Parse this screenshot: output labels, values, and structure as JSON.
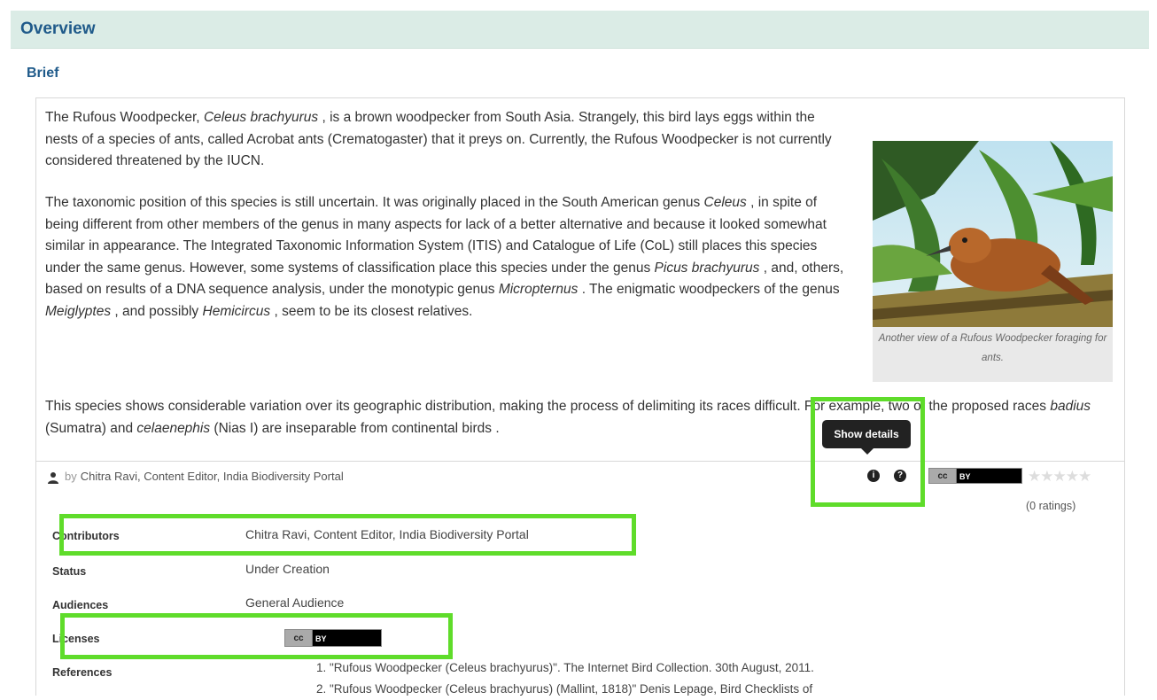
{
  "section": {
    "title": "Overview",
    "subtitle": "Brief"
  },
  "brief": {
    "p1_pre": "The Rufous Woodpecker, ",
    "p1_species": "Celeus brachyurus",
    "p1_post": " , is a brown woodpecker from South Asia. Strangely, this bird lays eggs within the nests of a species of ants, called Acrobat ants (Crematogaster) that it preys on. Currently, the Rufous Woodpecker is not currently considered threatened by the IUCN.",
    "p2_a": "The taxonomic position of this species is still uncertain. It was originally placed in the South American genus ",
    "p2_genus1": "Celeus",
    "p2_b": " , in spite of being different from other members of the genus in many aspects for lack of a better alternative and because it looked somewhat similar in appearance. The Integrated Taxonomic Information System (ITIS) and Catalogue of Life (CoL) still places this species under the same genus. However, some systems of classification place this species under the genus ",
    "p2_genus2": "Picus brachyurus",
    "p2_c": " , and, others, based on results of a DNA sequence analysis, under the monotypic genus ",
    "p2_genus3": "Micropternus",
    "p2_d": " . The enigmatic woodpeckers of the genus ",
    "p2_genus4": "Meiglyptes",
    "p2_e": " , and possibly ",
    "p2_genus5": "Hemicircus",
    "p2_f": " , seem to be its closest relatives.",
    "p3_a": "This species shows considerable variation over its geographic distribution, making the process of delimiting its races difficult. For example, two of the proposed races ",
    "p3_race1": "badius",
    "p3_b": "  (Sumatra) and ",
    "p3_race2": "celaenephis",
    "p3_c": "  (Nias I) are inseparable from continental birds ."
  },
  "figure": {
    "caption": "Another view of a Rufous Woodpecker foraging for ants."
  },
  "attribution": {
    "by_prefix": "by",
    "author": "Chitra Ravi, Content Editor, India Biodiversity Portal"
  },
  "tooltip": {
    "text": "Show details"
  },
  "buttons": {
    "details_icon": "info-icon",
    "help_icon": "help-icon"
  },
  "license_badge": {
    "cc": "cc",
    "by": "BY"
  },
  "rating": {
    "stars": "★★★★★",
    "count_text": "(0 ratings)"
  },
  "details": {
    "contributors_label": "Contributors",
    "contributors_value": "Chitra Ravi, Content Editor, India Biodiversity Portal",
    "status_label": "Status",
    "status_value": "Under Creation",
    "audiences_label": "Audiences",
    "audiences_value": "General Audience",
    "licenses_label": "Licenses",
    "references_label": "References"
  },
  "references": [
    "1.  \"Rufous Woodpecker (Celeus brachyurus)\". The Internet Bird Collection. 30th August, 2011.",
    "2.  \"Rufous Woodpecker (Celeus brachyurus) (Mallint, 1818)\" Denis Lepage, Bird Checklists of"
  ],
  "colors": {
    "highlight": "#5fdc2a",
    "header_bg": "#dbece6",
    "title_blue": "#1f5a8a"
  }
}
